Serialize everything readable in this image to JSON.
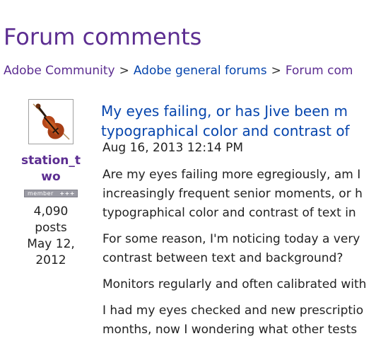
{
  "page": {
    "title": "Forum comments"
  },
  "breadcrumb": [
    {
      "label": "Adobe Community",
      "color": "#5c2d91"
    },
    {
      "label": "Adobe general forums",
      "color": "#0645ad"
    },
    {
      "label": "Forum com",
      "color": "#5c2d91"
    }
  ],
  "breadcrumb_separator": ">",
  "author": {
    "avatar_icon": "violin-icon",
    "name": "station_two",
    "badge_label": "member",
    "badge_stars": "+++",
    "post_count": "4,090",
    "post_count_label": "posts",
    "joined_date_line1": "May 12,",
    "joined_date_line2": "2012"
  },
  "post": {
    "title_line1": "My eyes failing, or has Jive been m",
    "title_line2": "typographical color and contrast of",
    "date": "Aug 16, 2013 12:14 PM",
    "paragraphs": [
      [
        "Are my eyes failing more egregiously, am I",
        "increasingly frequent senior moments, or h",
        "typographical color and contrast of text in"
      ],
      [
        "For some reason, I'm noticing today a very",
        "contrast between text and background?"
      ],
      [
        "Monitors regularly and often calibrated with"
      ],
      [
        "I had my eyes checked and new prescriptio",
        "months, now I wondering what other tests"
      ]
    ]
  }
}
